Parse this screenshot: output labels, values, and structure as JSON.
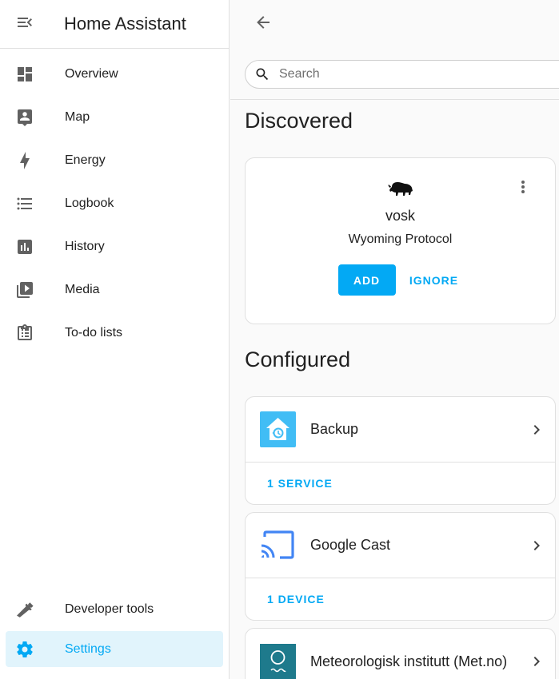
{
  "sidebar": {
    "title": "Home Assistant",
    "items": [
      {
        "label": "Overview",
        "icon": "view-dashboard-icon"
      },
      {
        "label": "Map",
        "icon": "map-account-icon"
      },
      {
        "label": "Energy",
        "icon": "lightning-bolt-icon"
      },
      {
        "label": "Logbook",
        "icon": "format-list-bulleted-icon"
      },
      {
        "label": "History",
        "icon": "chart-box-icon"
      },
      {
        "label": "Media",
        "icon": "play-box-multiple-icon"
      },
      {
        "label": "To-do lists",
        "icon": "clipboard-list-icon"
      }
    ],
    "bottom_items": [
      {
        "label": "Developer tools",
        "icon": "hammer-icon"
      },
      {
        "label": "Settings",
        "icon": "cog-icon",
        "active": true
      }
    ]
  },
  "search": {
    "placeholder": "Search"
  },
  "discovered": {
    "title": "Discovered",
    "card": {
      "name": "vosk",
      "protocol": "Wyoming Protocol",
      "add_label": "ADD",
      "ignore_label": "IGNORE"
    }
  },
  "configured": {
    "title": "Configured",
    "integrations": [
      {
        "name": "Backup",
        "footer": "1 SERVICE"
      },
      {
        "name": "Google Cast",
        "footer": "1 DEVICE"
      },
      {
        "name": "Meteorologisk institutt (Met.no)"
      }
    ]
  },
  "colors": {
    "accent": "#03a9f4",
    "icon_gray": "#616161",
    "active_bg": "#e1f4fc"
  }
}
